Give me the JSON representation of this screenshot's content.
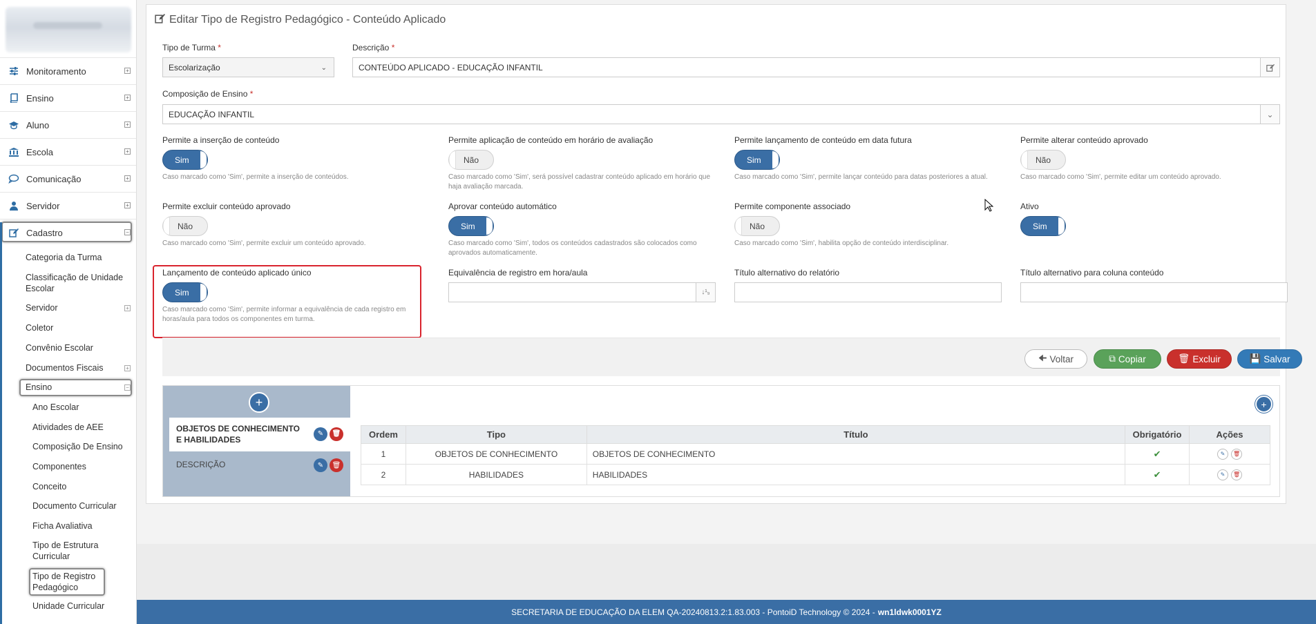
{
  "sidebar": {
    "main_items": [
      {
        "label": "Monitoramento",
        "icon": "sliders-icon"
      },
      {
        "label": "Ensino",
        "icon": "book-icon"
      },
      {
        "label": "Aluno",
        "icon": "graduation-cap-icon"
      },
      {
        "label": "Escola",
        "icon": "bank-icon"
      },
      {
        "label": "Comunicação",
        "icon": "comment-icon"
      },
      {
        "label": "Servidor",
        "icon": "user-icon"
      },
      {
        "label": "Cadastro",
        "icon": "edit-icon"
      }
    ],
    "cadastro_items": [
      "Categoria da Turma",
      "Classificação de Unidade Escolar",
      "Servidor",
      "Coletor",
      "Convênio Escolar",
      "Documentos Fiscais",
      "Ensino"
    ],
    "ensino_items": [
      "Ano Escolar",
      "Atividades de AEE",
      "Composição De Ensino",
      "Componentes",
      "Conceito",
      "Documento Curricular",
      "Ficha Avaliativa",
      "Tipo de Estrutura Curricular",
      "Tipo de Registro Pedagógico",
      "Unidade Curricular"
    ]
  },
  "page": {
    "title": "Editar Tipo de Registro Pedagógico - Conteúdo Aplicado"
  },
  "form": {
    "tipo_turma_label": "Tipo de Turma",
    "tipo_turma_value": "Escolarização",
    "descricao_label": "Descrição",
    "descricao_value": "CONTEÚDO APLICADO - EDUCAÇÃO INFANTIL",
    "composicao_label": "Composição de Ensino",
    "composicao_value": "EDUCAÇÃO INFANTIL",
    "required_mark": "*",
    "toggles": [
      {
        "label": "Permite a inserção de conteúdo",
        "value": "Sim",
        "on": true,
        "help": "Caso marcado como 'Sim', permite a inserção de conteúdos."
      },
      {
        "label": "Permite aplicação de conteúdo em horário de avaliação",
        "value": "Não",
        "on": false,
        "help": "Caso marcado como 'Sim', será possível cadastrar conteúdo aplicado em horário que haja avaliação marcada."
      },
      {
        "label": "Permite lançamento de conteúdo em data futura",
        "value": "Sim",
        "on": true,
        "help": "Caso marcado como 'Sim', permite lançar conteúdo para datas posteriores a atual."
      },
      {
        "label": "Permite alterar conteúdo aprovado",
        "value": "Não",
        "on": false,
        "help": "Caso marcado como 'Sim', permite editar um conteúdo aprovado."
      },
      {
        "label": "Permite excluir conteúdo aprovado",
        "value": "Não",
        "on": false,
        "help": "Caso marcado como 'Sim', permite excluir um conteúdo aprovado."
      },
      {
        "label": "Aprovar conteúdo automático",
        "value": "Sim",
        "on": true,
        "help": "Caso marcado como 'Sim', todos os conteúdos cadastrados são colocados como aprovados automaticamente."
      },
      {
        "label": "Permite componente associado",
        "value": "Não",
        "on": false,
        "help": "Caso marcado como 'Sim', habilita opção de conteúdo interdisciplinar."
      },
      {
        "label": "Ativo",
        "value": "Sim",
        "on": true,
        "help": ""
      },
      {
        "label": "Lançamento de conteúdo aplicado único",
        "value": "Sim",
        "on": true,
        "help": "Caso marcado como 'Sim', permite informar a equivalência de cada registro em horas/aula para todos os componentes em turma."
      }
    ],
    "equivalencia_label": "Equivalência de registro em hora/aula",
    "titulo_relatorio_label": "Título alternativo do relatório",
    "titulo_coluna_label": "Título alternativo para coluna conteúdo"
  },
  "actions": {
    "voltar": "Voltar",
    "copiar": "Copiar",
    "excluir": "Excluir",
    "salvar": "Salvar"
  },
  "sections": [
    "OBJETOS DE CONHECIMENTO E HABILIDADES",
    "DESCRIÇÃO"
  ],
  "table": {
    "headers": [
      "Ordem",
      "Tipo",
      "Título",
      "Obrigatório",
      "Ações"
    ],
    "rows": [
      {
        "ordem": "1",
        "tipo": "OBJETOS DE CONHECIMENTO",
        "titulo": "OBJETOS DE CONHECIMENTO",
        "obrigatorio": true
      },
      {
        "ordem": "2",
        "tipo": "HABILIDADES",
        "titulo": "HABILIDADES",
        "obrigatorio": true
      }
    ]
  },
  "footer": {
    "text": "SECRETARIA DE EDUCAÇÃO DA ELEM QA-20240813.2:1.83.003 - PontoiD Technology © 2024 -",
    "bold": "wn1ldwk0001YZ"
  },
  "colors": {
    "primary": "#3a6ea5",
    "success": "#5aa25a",
    "danger": "#c9302c",
    "highlight": "#d9232d"
  }
}
